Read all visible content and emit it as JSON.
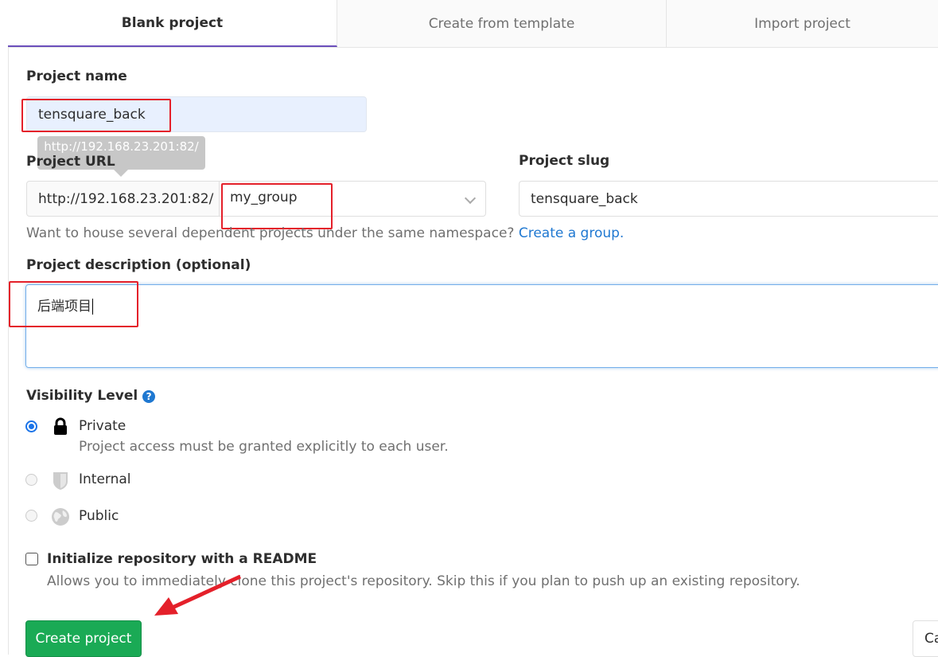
{
  "tabs": [
    {
      "label": "Blank project",
      "active": true
    },
    {
      "label": "Create from template"
    },
    {
      "label": "Import project"
    }
  ],
  "project_name": {
    "label": "Project name",
    "value": "tensquare_back"
  },
  "project_url": {
    "label": "Project URL",
    "prefix": "http://192.168.23.201:82/",
    "namespace": "my_group",
    "tooltip": "http://192.168.23.201:82/"
  },
  "project_slug": {
    "label": "Project slug",
    "value": "tensquare_back"
  },
  "namespace_help": {
    "text": "Want to house several dependent projects under the same namespace?",
    "link": "Create a group."
  },
  "description": {
    "label": "Project description (optional)",
    "value": "后端项目"
  },
  "visibility": {
    "label": "Visibility Level",
    "options": [
      {
        "label": "Private",
        "description": "Project access must be granted explicitly to each user.",
        "icon": "lock-icon",
        "selected": true
      },
      {
        "label": "Internal",
        "icon": "shield-icon",
        "selected": false
      },
      {
        "label": "Public",
        "icon": "globe-icon",
        "selected": false
      }
    ]
  },
  "readme": {
    "label": "Initialize repository with a README",
    "description": "Allows you to immediately clone this project's repository. Skip this if you plan to push up an existing repository.",
    "checked": false
  },
  "buttons": {
    "create": "Create project",
    "cancel": "Ca"
  },
  "colors": {
    "accent": "#6b4fbb",
    "primary_button": "#1aaa55",
    "link": "#1f78d1",
    "annotation": "#e4202a"
  }
}
